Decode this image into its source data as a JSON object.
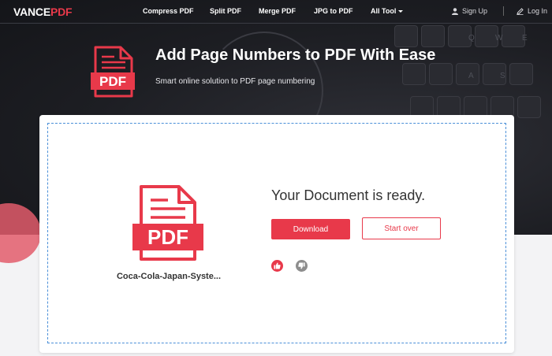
{
  "nav": {
    "logo_white": "VANCE",
    "logo_red": "PDF",
    "items": [
      "Compress PDF",
      "Split PDF",
      "Merge PDF",
      "JPG to PDF",
      "All Tool"
    ],
    "signup": "Sign Up",
    "login": "Log In"
  },
  "hero": {
    "title": "Add Page Numbers to PDF With Ease",
    "subtitle": "Smart online solution to PDF page numbering",
    "icon_label": "PDF"
  },
  "result": {
    "file_icon_label": "PDF",
    "filename": "Coca-Cola-Japan-Syste...",
    "message": "Your Document is ready.",
    "download_label": "Download",
    "startover_label": "Start over"
  },
  "colors": {
    "accent": "#e8394a",
    "hero_bg": "#1d1e23",
    "dash_border": "#4a8fd8"
  },
  "icons": [
    "user-icon",
    "pencil-icon",
    "thumbs-up-icon",
    "thumbs-down-icon",
    "pdf-file-icon",
    "chevron-down-icon"
  ]
}
